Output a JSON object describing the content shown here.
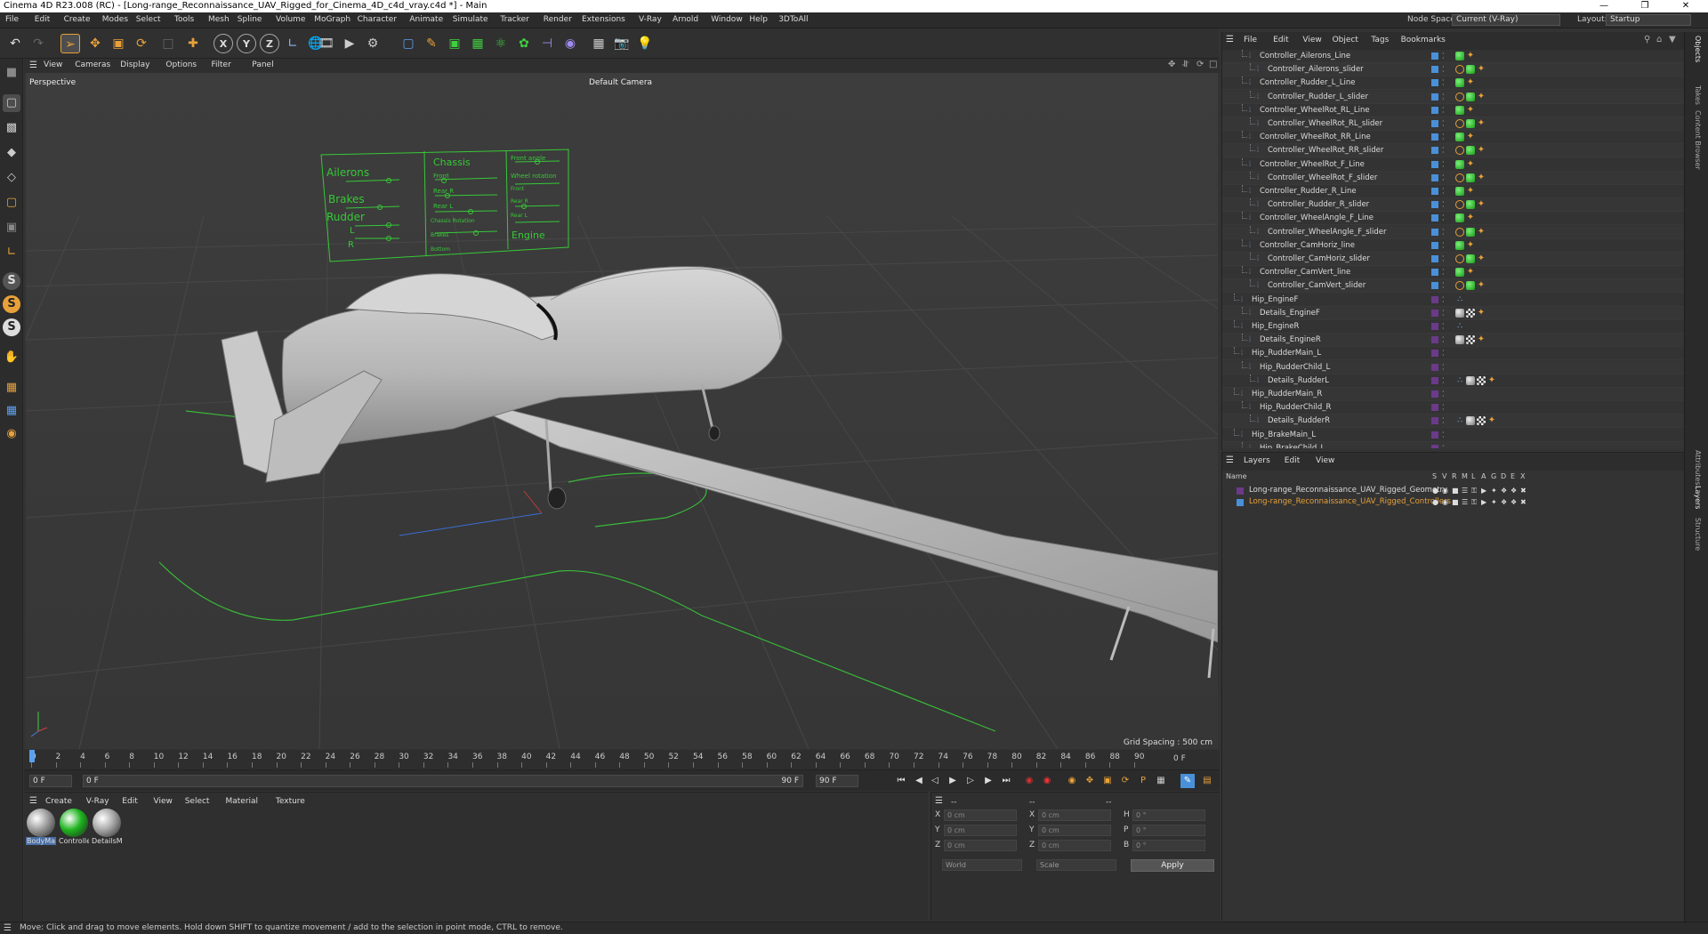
{
  "window": {
    "title": "Cinema 4D R23.008 (RC) - [Long-range_Reconnaissance_UAV_Rigged_for_Cinema_4D_c4d_vray.c4d *] - Main"
  },
  "menubar": {
    "items": [
      "File",
      "Edit",
      "Create",
      "Modes",
      "Select",
      "Tools",
      "Mesh",
      "Spline",
      "Volume",
      "MoGraph",
      "Character",
      "Animate",
      "Simulate",
      "Tracker",
      "Render",
      "Extensions",
      "V-Ray",
      "Arnold",
      "Window",
      "Help",
      "3DToAll"
    ],
    "node_space_label": "Node Space:",
    "node_space_value": "Current (V-Ray)",
    "layout_label": "Layout:",
    "layout_value": "Startup"
  },
  "viewport": {
    "menu": [
      "View",
      "Cameras",
      "Display",
      "Options",
      "Filter",
      "Panel"
    ],
    "label": "Perspective",
    "camera": "Default Camera",
    "grid_spacing": "Grid Spacing : 500 cm",
    "hud": {
      "col1": [
        "Ailerons",
        "Brakes",
        "Rudder",
        "L",
        "R"
      ],
      "col2": [
        "Chassis",
        "Front",
        "Rear R",
        "Rear L",
        "Chassis Rotation",
        "Brakes",
        "Bottom"
      ],
      "col3": [
        "Front angle",
        "Wheel rotation",
        "Front",
        "Rear R",
        "Rear L",
        "Engine"
      ]
    }
  },
  "timeline": {
    "ticks": [
      "0",
      "2",
      "4",
      "6",
      "8",
      "10",
      "12",
      "14",
      "16",
      "18",
      "20",
      "22",
      "24",
      "26",
      "28",
      "30",
      "32",
      "34",
      "36",
      "38",
      "40",
      "42",
      "44",
      "46",
      "48",
      "50",
      "52",
      "54",
      "56",
      "58",
      "60",
      "62",
      "64",
      "66",
      "68",
      "70",
      "72",
      "74",
      "76",
      "78",
      "80",
      "82",
      "84",
      "86",
      "88",
      "90"
    ],
    "current_frame_right": "0 F"
  },
  "transport": {
    "start": "0 F",
    "current": "0 F",
    "end": "90 F",
    "max": "90 F"
  },
  "materials": {
    "menu": [
      "Create",
      "V-Ray",
      "Edit",
      "View",
      "Select",
      "Material",
      "Texture"
    ],
    "items": [
      {
        "label": "BodyMa",
        "color": "#9a9a9a"
      },
      {
        "label": "Controlle",
        "color": "#1db31d"
      },
      {
        "label": "DetailsM",
        "color": "#a5a5a5"
      }
    ]
  },
  "coordinates": {
    "header1": "--",
    "header2": "--",
    "header3": "--",
    "rows": [
      {
        "a": "X",
        "av": "0 cm",
        "b": "X",
        "bv": "0 cm",
        "c": "H",
        "cv": "0 °"
      },
      {
        "a": "Y",
        "av": "0 cm",
        "b": "Y",
        "bv": "0 cm",
        "c": "P",
        "cv": "0 °"
      },
      {
        "a": "Z",
        "av": "0 cm",
        "b": "Z",
        "bv": "0 cm",
        "c": "B",
        "cv": "0 °"
      }
    ],
    "mode1": "World",
    "mode2": "Scale",
    "apply": "Apply"
  },
  "objects": {
    "menu": [
      "File",
      "Edit",
      "View",
      "Object",
      "Tags",
      "Bookmarks"
    ],
    "rows": [
      {
        "name": "Controller_Ailerons_Line",
        "depth": 2,
        "layer": "#4a90d9",
        "tags": [
          "green-tag",
          "orange-tag"
        ]
      },
      {
        "name": "Controller_Ailerons_slider",
        "depth": 3,
        "layer": "#4a90d9",
        "tags": [
          "no-tag",
          "green-tag",
          "orange-tag"
        ]
      },
      {
        "name": "Controller_Rudder_L_Line",
        "depth": 2,
        "layer": "#4a90d9",
        "tags": [
          "green-tag",
          "orange-tag"
        ]
      },
      {
        "name": "Controller_Rudder_L_slider",
        "depth": 3,
        "layer": "#4a90d9",
        "tags": [
          "no-tag",
          "green-tag",
          "orange-tag"
        ]
      },
      {
        "name": "Controller_WheelRot_RL_Line",
        "depth": 2,
        "layer": "#4a90d9",
        "tags": [
          "green-tag",
          "orange-tag"
        ]
      },
      {
        "name": "Controller_WheelRot_RL_slider",
        "depth": 3,
        "layer": "#4a90d9",
        "tags": [
          "no-tag",
          "green-tag",
          "orange-tag"
        ]
      },
      {
        "name": "Controller_WheelRot_RR_Line",
        "depth": 2,
        "layer": "#4a90d9",
        "tags": [
          "green-tag",
          "orange-tag"
        ]
      },
      {
        "name": "Controller_WheelRot_RR_slider",
        "depth": 3,
        "layer": "#4a90d9",
        "tags": [
          "no-tag",
          "green-tag",
          "orange-tag"
        ]
      },
      {
        "name": "Controller_WheelRot_F_Line",
        "depth": 2,
        "layer": "#4a90d9",
        "tags": [
          "green-tag",
          "orange-tag"
        ]
      },
      {
        "name": "Controller_WheelRot_F_slider",
        "depth": 3,
        "layer": "#4a90d9",
        "tags": [
          "no-tag",
          "green-tag",
          "orange-tag"
        ]
      },
      {
        "name": "Controller_Rudder_R_Line",
        "depth": 2,
        "layer": "#4a90d9",
        "tags": [
          "green-tag",
          "orange-tag"
        ]
      },
      {
        "name": "Controller_Rudder_R_slider",
        "depth": 3,
        "layer": "#4a90d9",
        "tags": [
          "no-tag",
          "green-tag",
          "orange-tag"
        ]
      },
      {
        "name": "Controller_WheelAngle_F_Line",
        "depth": 2,
        "layer": "#4a90d9",
        "tags": [
          "green-tag",
          "orange-tag"
        ]
      },
      {
        "name": "Controller_WheelAngle_F_slider",
        "depth": 3,
        "layer": "#4a90d9",
        "tags": [
          "no-tag",
          "green-tag",
          "orange-tag"
        ]
      },
      {
        "name": "Controller_CamHoriz_line",
        "depth": 2,
        "layer": "#4a90d9",
        "tags": [
          "green-tag",
          "orange-tag"
        ]
      },
      {
        "name": "Controller_CamHoriz_slider",
        "depth": 3,
        "layer": "#4a90d9",
        "tags": [
          "no-tag",
          "green-tag",
          "orange-tag"
        ]
      },
      {
        "name": "Controller_CamVert_line",
        "depth": 2,
        "layer": "#4a90d9",
        "tags": [
          "green-tag",
          "orange-tag"
        ]
      },
      {
        "name": "Controller_CamVert_slider",
        "depth": 3,
        "layer": "#4a90d9",
        "tags": [
          "no-tag",
          "green-tag",
          "orange-tag"
        ]
      },
      {
        "name": "Hip_EngineF",
        "depth": 1,
        "layer": "#6b3a8a",
        "tags": [
          "joint-tag"
        ]
      },
      {
        "name": "Details_EngineF",
        "depth": 2,
        "layer": "#6b3a8a",
        "tags": [
          "grey-tag",
          "checker-tag",
          "orange-tag"
        ]
      },
      {
        "name": "Hip_EngineR",
        "depth": 1,
        "layer": "#6b3a8a",
        "tags": [
          "joint-tag"
        ]
      },
      {
        "name": "Details_EngineR",
        "depth": 2,
        "layer": "#6b3a8a",
        "tags": [
          "grey-tag",
          "checker-tag",
          "orange-tag"
        ]
      },
      {
        "name": "Hip_RudderMain_L",
        "depth": 1,
        "layer": "#6b3a8a",
        "tags": []
      },
      {
        "name": "Hip_RudderChild_L",
        "depth": 2,
        "layer": "#6b3a8a",
        "tags": []
      },
      {
        "name": "Details_RudderL",
        "depth": 3,
        "layer": "#6b3a8a",
        "tags": [
          "joint-tag",
          "grey-tag",
          "checker-tag",
          "orange-tag"
        ]
      },
      {
        "name": "Hip_RudderMain_R",
        "depth": 1,
        "layer": "#6b3a8a",
        "tags": []
      },
      {
        "name": "Hip_RudderChild_R",
        "depth": 2,
        "layer": "#6b3a8a",
        "tags": []
      },
      {
        "name": "Details_RudderR",
        "depth": 3,
        "layer": "#6b3a8a",
        "tags": [
          "joint-tag",
          "grey-tag",
          "checker-tag",
          "orange-tag"
        ]
      },
      {
        "name": "Hip_BrakeMain_L",
        "depth": 1,
        "layer": "#6b3a8a",
        "tags": []
      },
      {
        "name": "Hip_BrakeChild_L",
        "depth": 2,
        "layer": "#6b3a8a",
        "tags": []
      }
    ]
  },
  "layers": {
    "menu": [
      "Layers",
      "Edit",
      "View"
    ],
    "columns": [
      "Name",
      "S",
      "V",
      "R",
      "M",
      "L",
      "A",
      "G",
      "D",
      "E",
      "X"
    ],
    "rows": [
      {
        "name": "Long-range_Reconnaissance_UAV_Rigged_Geometry",
        "color": "#6b3a8a",
        "text_color": "#dddddd"
      },
      {
        "name": "Long-range_Reconnaissance_UAV_Rigged_Controllers",
        "color": "#4a90d9",
        "text_color": "#e8a13a"
      }
    ]
  },
  "right_tabs": [
    "Objects",
    "Takes",
    "Content Browser",
    "Attributes",
    "Layers",
    "Structure"
  ],
  "status": {
    "text": "Move: Click and drag to move elements. Hold down SHIFT to quantize movement / add to the selection in point mode, CTRL to remove."
  },
  "colors": {
    "accent_orange": "#e8a13a",
    "controller_green": "#3fcf3f",
    "selection_blue": "#4a90d9"
  }
}
